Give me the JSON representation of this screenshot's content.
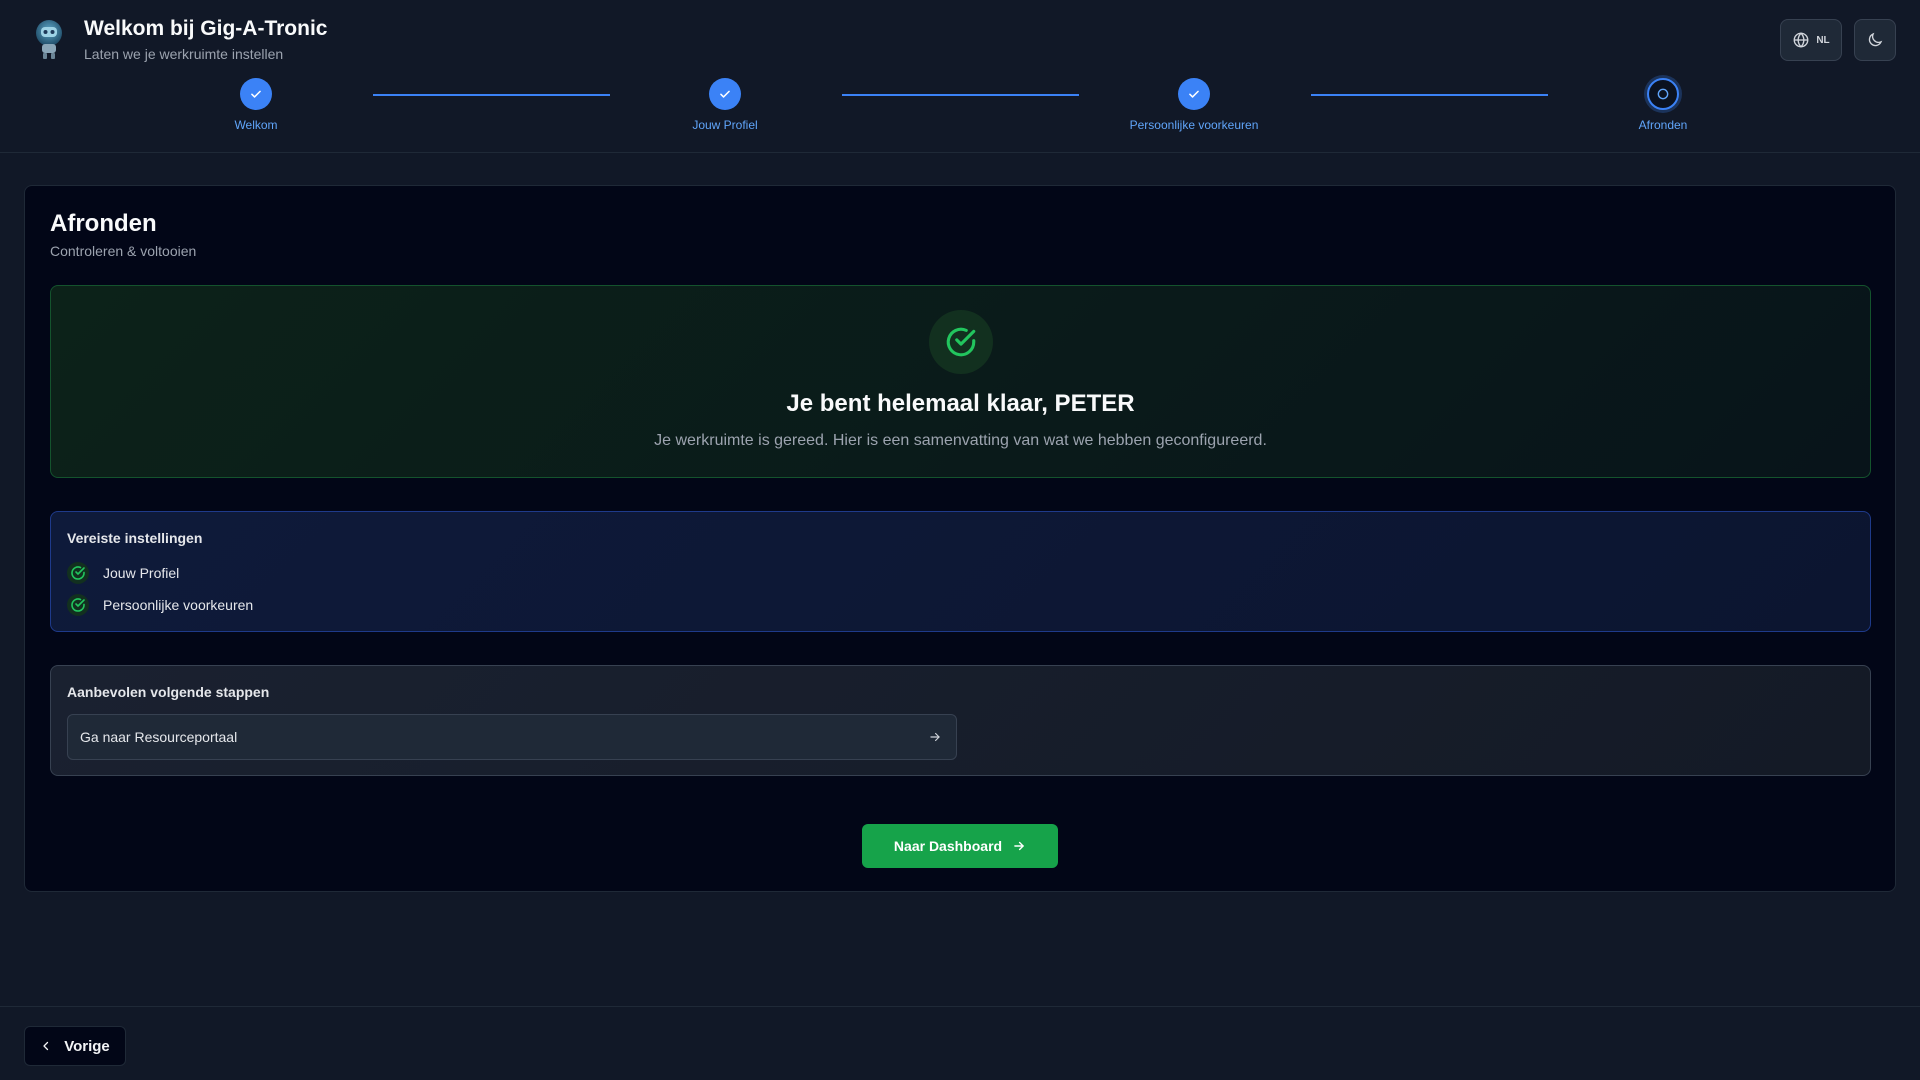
{
  "header": {
    "title": "Welkom bij Gig-A-Tronic",
    "subtitle": "Laten we je werkruimte instellen",
    "language_code": "NL"
  },
  "icons": {
    "logo": "robot-logo",
    "language": "globe-icon",
    "theme": "moon-icon",
    "step_done": "check-icon",
    "step_current": "circle-icon",
    "success": "circle-check-icon",
    "arrow": "arrow-right-icon",
    "back": "chevron-left-icon"
  },
  "steps": [
    {
      "label": "Welkom",
      "state": "done"
    },
    {
      "label": "Jouw Profiel",
      "state": "done"
    },
    {
      "label": "Persoonlijke voorkeuren",
      "state": "done"
    },
    {
      "label": "Afronden",
      "state": "current"
    }
  ],
  "card": {
    "title": "Afronden",
    "subtitle": "Controleren & voltooien",
    "success_title": "Je bent helemaal klaar, PETER",
    "success_text": "Je werkruimte is gereed. Hier is een samenvatting van wat we hebben geconfigureerd.",
    "required_heading": "Vereiste instellingen",
    "required_items": [
      "Jouw Profiel",
      "Persoonlijke voorkeuren"
    ],
    "next_heading": "Aanbevolen volgende stappen",
    "next_link": "Ga naar Resourceportaal",
    "dashboard_button": "Naar Dashboard"
  },
  "footer": {
    "prev_button": "Vorige"
  },
  "colors": {
    "background": "#111827",
    "accent_blue": "#3b82f6",
    "success_green": "#16a34a",
    "card_bg": "#020617"
  }
}
